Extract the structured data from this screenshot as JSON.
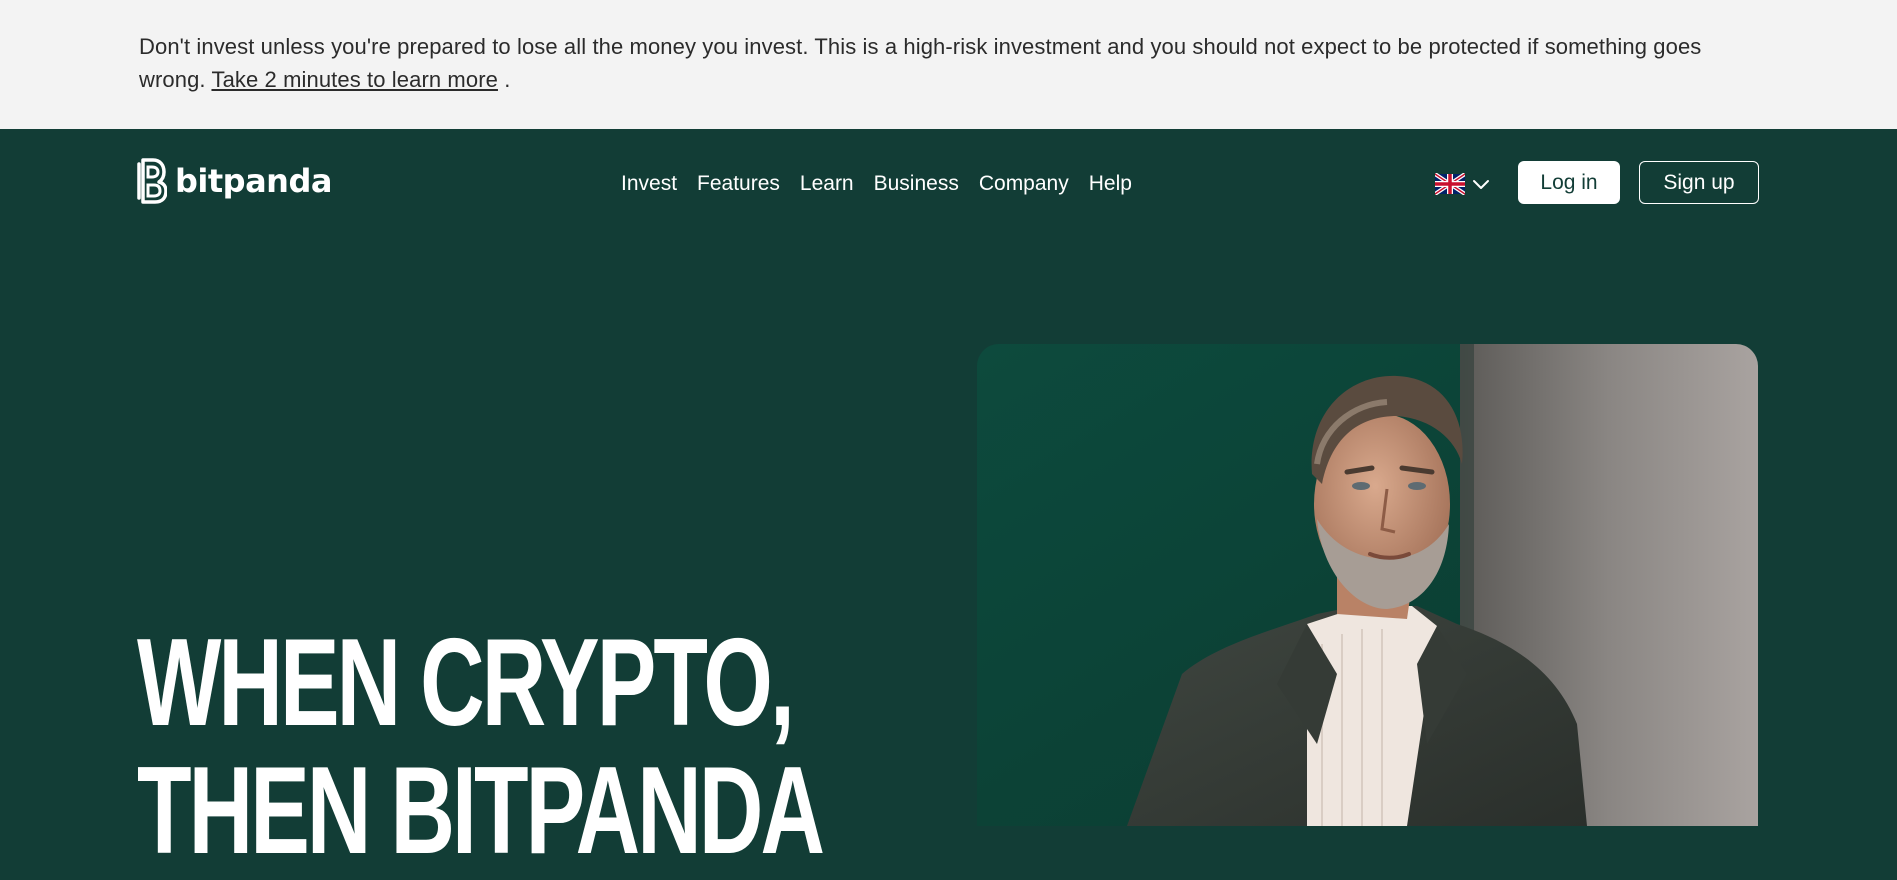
{
  "risk_banner": {
    "text": "Don't invest unless you're prepared to lose all the money you invest. This is a high-risk investment and you should not expect to be protected if something goes wrong.",
    "link_text": "Take 2 minutes to learn more",
    "suffix": "."
  },
  "header": {
    "logo_text": "bitpanda",
    "nav": [
      "Invest",
      "Features",
      "Learn",
      "Business",
      "Company",
      "Help"
    ],
    "language_icon": "uk-flag-icon",
    "login_label": "Log in",
    "signup_label": "Sign up"
  },
  "hero": {
    "headline_line1": "WHEN CRYPTO,",
    "headline_line2": "THEN BITPANDA"
  },
  "colors": {
    "brand_green": "#123d36",
    "banner_bg": "#f3f3f3",
    "white": "#ffffff"
  }
}
